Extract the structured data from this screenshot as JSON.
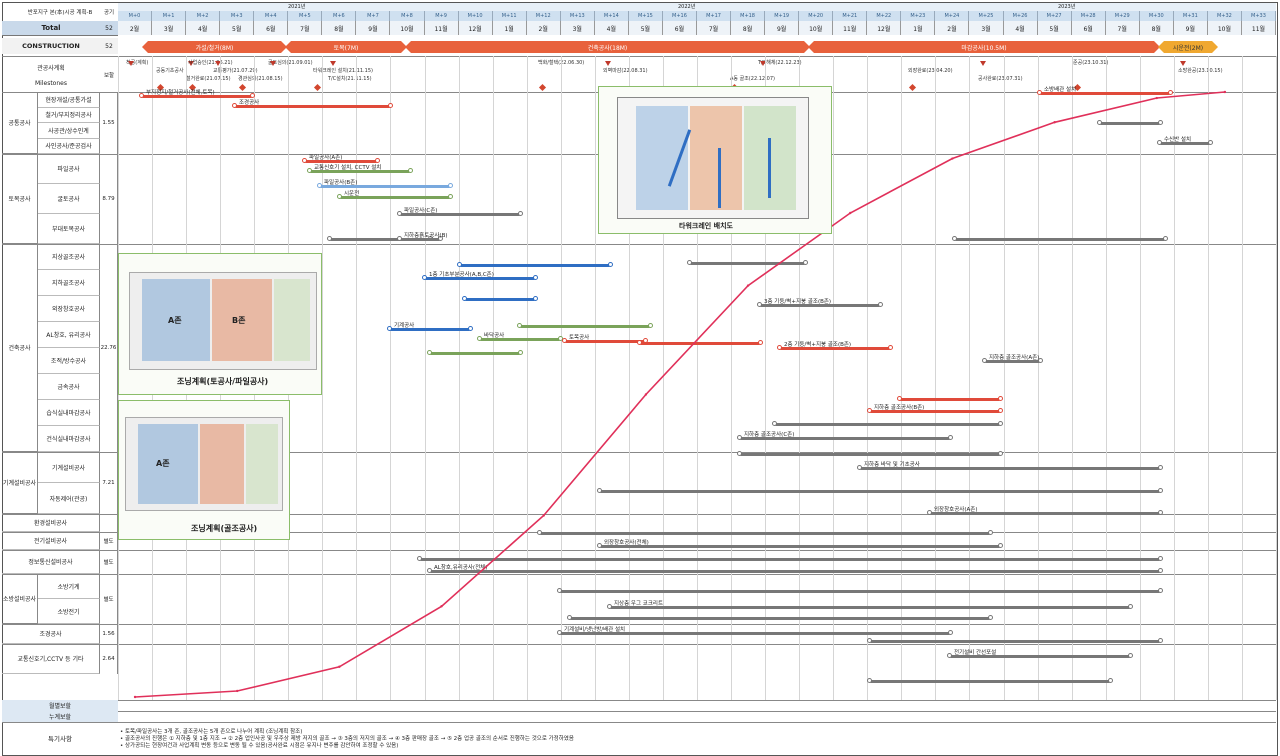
{
  "corner_label": "반포지구 본(本)시공 계획-B",
  "header": {
    "col_period": "공기",
    "total_label": "Total",
    "total_value": "52",
    "years": [
      "2021년",
      "2022년",
      "2023년"
    ],
    "month_offsets": [
      "M+0",
      "M+1",
      "M+2",
      "M+3",
      "M+4",
      "M+5",
      "M+6",
      "M+7",
      "M+8",
      "M+9",
      "M+10",
      "M+11",
      "M+12",
      "M+13",
      "M+14",
      "M+15",
      "M+16",
      "M+17",
      "M+18",
      "M+19",
      "M+20",
      "M+21",
      "M+22",
      "M+23",
      "M+24",
      "M+25",
      "M+26",
      "M+27",
      "M+28",
      "M+29",
      "M+30",
      "M+31",
      "M+32",
      "M+33"
    ],
    "months": [
      "2월",
      "3월",
      "4월",
      "5월",
      "6월",
      "7월",
      "8월",
      "9월",
      "10월",
      "11월",
      "12월",
      "1월",
      "2월",
      "3월",
      "4월",
      "5월",
      "6월",
      "7월",
      "8월",
      "9월",
      "10월",
      "11월",
      "12월",
      "1월",
      "2월",
      "3월",
      "4월",
      "5월",
      "6월",
      "7월",
      "8월",
      "9월",
      "10월",
      "11월"
    ]
  },
  "construction": {
    "label": "CONSTRUCTION",
    "value": "52",
    "phases": [
      "가설/철거(8M)",
      "토목(7M)",
      "건축공사(18M)",
      "마감공사(10.5M)",
      "시운전(2M)"
    ]
  },
  "milestones": {
    "label_kr": "관공사계획",
    "label_en": "Milestones",
    "value": "보할",
    "items": [
      "착공(계획)",
      "공동기초공사",
      "철거완료(21.07.15)",
      "사업승인(21.06.21)",
      "교통평가(21.07.29)",
      "경관심의(21.08.15)",
      "굴토심의(21.09.01)",
      "타워크레인 설치(21.11.15)",
      "T/C설치(21.11.15)",
      "백화/철택(22.06.30)",
      "외벽마감(22.08.31)",
      "A동 골조(22.12.07)",
      "T/C해체(22.12.23)",
      "외장완료(23.04.20)",
      "공사완료(23.07.31)",
      "준공(23.10.31)",
      "소방완공(23.10.15)"
    ]
  },
  "rows": [
    {
      "group": "공통공사",
      "items": [
        "현장개설/공통가설",
        "철거/부지정리공사",
        "사공관/상수인계",
        "사인공사/준공검사"
      ],
      "value": "1.55"
    },
    {
      "group": "토목공사",
      "items": [
        "파일공사",
        "굴토공사",
        "부대토목공사"
      ],
      "value": "8.79"
    },
    {
      "group": "건축공사",
      "items": [
        "지상골조공사",
        "지하골조공사",
        "외장창호공사",
        "AL창호, 유리공사",
        "조적/방수공사",
        "금속공사",
        "습식실내마감공사",
        "건식실내마감공사"
      ],
      "value": "22.76"
    },
    {
      "group": "기계설비공사",
      "items": [
        "기계설비공사",
        "자동제어(관공)"
      ],
      "value": "7.21"
    },
    {
      "group": "",
      "items": [
        "환경설비공사"
      ],
      "value": ""
    },
    {
      "group": "",
      "items": [
        "전기설비공사"
      ],
      "value": "별도"
    },
    {
      "group": "",
      "items": [
        "정보통신설비공사"
      ],
      "value": "별도"
    },
    {
      "group": "소방설비공사",
      "items": [
        "소방기계",
        "소방전기"
      ],
      "value": "별도"
    },
    {
      "group": "",
      "items": [
        "조경공사"
      ],
      "value": "1.56"
    },
    {
      "group": "",
      "items": [
        "교통신호기,CCTV 등 기타"
      ],
      "value": "2.64"
    }
  ],
  "bottom": {
    "monthly_label": "월별보할",
    "cumulative_label": "누계보할",
    "notes_label": "특기사항",
    "notes": [
      "• 토목/파일공사는 3개 존, 골조공사는 5개 존으로 나누어 계획 (조닝계획 참조)",
      "• 골조공사의 진행은 ① 지하층 및 1층 지조 → ② 2층 업인사공 및 우주상 제방 저지의 골조 → ③ 3층의 저지의 골조 → ④ 3층 판매장 골조 → ⑤ 2층 업공 골조의 순서로 진행하는 것으로 가정하였음",
      "• 상가공되는 현장여건과 사업계획 변동 등으로 변동 될 수 있음(공사완료 시점은 유지나 변주를 감안하여 조정할 수 있음)"
    ]
  },
  "insets": {
    "tower_crane": "타워크레인 배치도",
    "zoning_upper": "조닝계획(토공사/파일공사)",
    "zoning_lower": "조닝계획(골조공사)",
    "zone_a": "A존",
    "zone_b": "B존"
  },
  "bar_labels": [
    "부지정지/철거공사(전체,토목)",
    "파일공사(A존)",
    "파일공사(B존)",
    "파일공사(C존)",
    "지하층흙토공사(B)",
    "1층 기초부분공사(A,B,C존)",
    "기계공사",
    "바닥공사",
    "토목공사",
    "2층 기둥/벽+지붕 골조(B존)",
    "3층 기둥/벽+지붕 골조(B존)",
    "지하층 골조공사(A존)",
    "지하층 골조공사(B존)",
    "지하층 골조공사(C존)",
    "지하층 바닥 및 기초공사",
    "외장창호공사(A존)",
    "외장창호공사(전체)",
    "AL창호,유리공사(전체)",
    "지상층 우그 코크리트",
    "기계설비/냉난방/배관 설치",
    "전기설비 간선포설",
    "소방배관 설치",
    "수신반 설치",
    "조경공사",
    "교통신호기 설치, CCTV 설치",
    "시운전"
  ],
  "colors": {
    "accent_red": "#e04a3a",
    "accent_blue": "#2f6ec3",
    "accent_green": "#7aa35a",
    "header_blue": "#cfe0f0",
    "curve": "#e0305a"
  },
  "chart_data": {
    "type": "line",
    "title": "",
    "xlabel": "",
    "ylabel": "",
    "x": [
      "M+0",
      "M+3",
      "M+6",
      "M+9",
      "M+12",
      "M+15",
      "M+18",
      "M+21",
      "M+24",
      "M+27",
      "M+30",
      "M+32"
    ],
    "series": [
      {
        "name": "",
        "values": [
          0,
          1,
          5,
          15,
          30,
          50,
          68,
          80,
          89,
          95,
          99,
          100
        ]
      }
    ],
    "ylim": [
      0,
      100
    ]
  }
}
